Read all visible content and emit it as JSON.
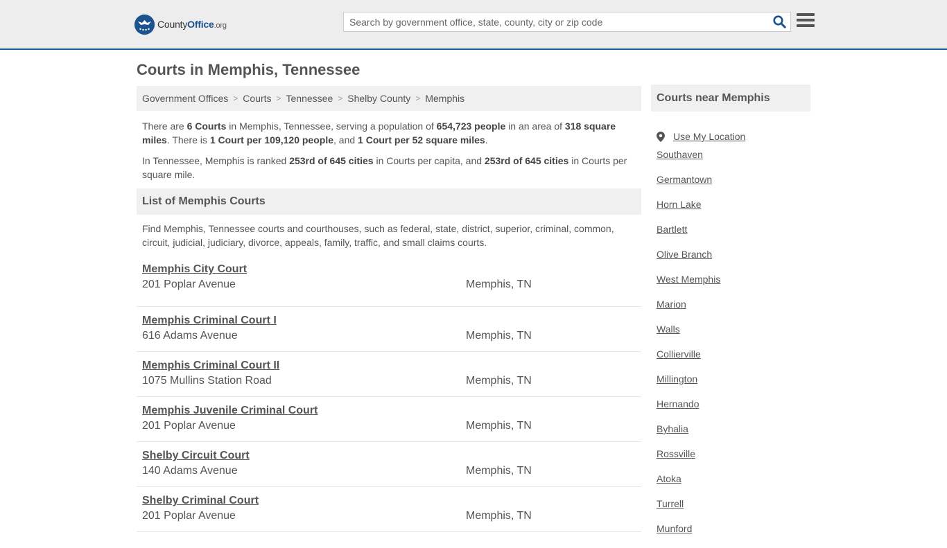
{
  "header": {
    "logo": {
      "county": "County",
      "office": "Office",
      "org": ".org"
    },
    "search_placeholder": "Search by government office, state, county, city or zip code"
  },
  "page_title": "Courts in Memphis, Tennessee",
  "breadcrumb": [
    "Government Offices",
    "Courts",
    "Tennessee",
    "Shelby County",
    "Memphis"
  ],
  "intro": {
    "p1": {
      "a": "There are ",
      "b": "6 Courts",
      "c": " in Memphis, Tennessee, serving a population of ",
      "d": "654,723 people",
      "e": " in an area of ",
      "f": "318 square miles",
      "g": ". There is ",
      "h": "1 Court per 109,120 people",
      "i": ", and ",
      "j": "1 Court per 52 square miles",
      "k": "."
    },
    "p2": {
      "a": "In Tennessee, Memphis is ranked ",
      "b": "253rd of 645 cities",
      "c": " in Courts per capita, and ",
      "d": "253rd of 645 cities",
      "e": " in Courts per square mile."
    }
  },
  "list_section": {
    "title": "List of Memphis Courts",
    "description": "Find Memphis, Tennessee courts and courthouses, such as federal, state, district, superior, criminal, common, circuit, judicial, judiciary, divorce, appeals, family, traffic, and small claims courts."
  },
  "courts": [
    {
      "name": "Memphis City Court",
      "address": "201 Poplar Avenue",
      "city": "Memphis, TN"
    },
    {
      "name": "Memphis Criminal Court I",
      "address": "616 Adams Avenue",
      "city": "Memphis, TN"
    },
    {
      "name": "Memphis Criminal Court II",
      "address": "1075 Mullins Station Road",
      "city": "Memphis, TN"
    },
    {
      "name": "Memphis Juvenile Criminal Court",
      "address": "201 Poplar Avenue",
      "city": "Memphis, TN"
    },
    {
      "name": "Shelby Circuit Court",
      "address": "140 Adams Avenue",
      "city": "Memphis, TN"
    },
    {
      "name": "Shelby Criminal Court",
      "address": "201 Poplar Avenue",
      "city": "Memphis, TN"
    }
  ],
  "sidebar": {
    "title": "Courts near Memphis",
    "use_location": "Use My Location",
    "cities": [
      "Southaven",
      "Germantown",
      "Horn Lake",
      "Bartlett",
      "Olive Branch",
      "West Memphis",
      "Marion",
      "Walls",
      "Collierville",
      "Millington",
      "Hernando",
      "Byhalia",
      "Rossville",
      "Atoka",
      "Turrell",
      "Munford"
    ]
  },
  "colors": {
    "brand": "#1b5390",
    "header_bg": "#ededed",
    "panel_bg": "#f0f0f0",
    "text": "#555555"
  },
  "icons": [
    "logo-seal-icon",
    "search-icon",
    "hamburger-menu-icon",
    "location-pin-icon"
  ]
}
